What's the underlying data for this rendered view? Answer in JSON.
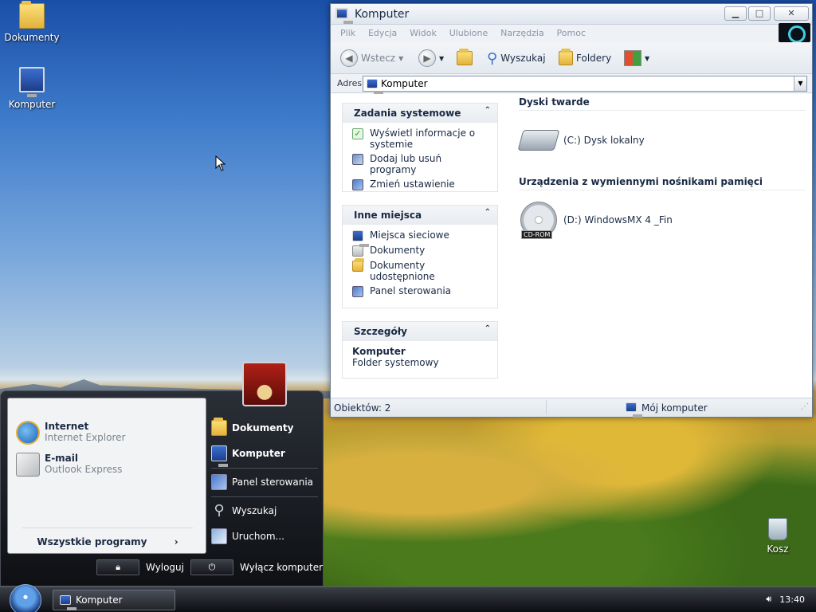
{
  "desktop": {
    "icons": [
      {
        "label": "Dokumenty"
      },
      {
        "label": "Komputer"
      },
      {
        "label": "Kosz"
      }
    ]
  },
  "window": {
    "title": "Komputer",
    "controls": {
      "minimize": "▁",
      "maximize": "□",
      "close": "✕"
    },
    "menu": [
      "Plik",
      "Edycja",
      "Widok",
      "Ulubione",
      "Narzędzia",
      "Pomoc"
    ],
    "toolbar": {
      "back": "Wstecz",
      "search": "Wyszukaj",
      "folders": "Foldery"
    },
    "address": {
      "label": "Adres",
      "value": "Komputer"
    },
    "panels": {
      "system_tasks": {
        "title": "Zadania systemowe",
        "items": [
          "Wyświetl informacje o systemie",
          "Dodaj lub usuń programy",
          "Zmień ustawienie"
        ]
      },
      "other_places": {
        "title": "Inne miejsca",
        "items": [
          "Miejsca sieciowe",
          "Dokumenty",
          "Dokumenty udostępnione",
          "Panel sterowania"
        ]
      },
      "details": {
        "title": "Szczegóły",
        "name": "Komputer",
        "desc": "Folder systemowy"
      }
    },
    "groups": {
      "hard_disks": {
        "title": "Dyski twarde",
        "items": [
          "(C:) Dysk lokalny"
        ]
      },
      "removable": {
        "title": "Urządzenia z wymiennymi nośnikami pamięci",
        "items": [
          "(D:) WindowsMX 4 _Fin"
        ],
        "badge": "CD-ROM"
      }
    },
    "status": {
      "left": "Obiektów: 2",
      "right": "Mój komputer"
    }
  },
  "start_menu": {
    "pinned": [
      {
        "title": "Internet",
        "subtitle": "Internet Explorer"
      },
      {
        "title": "E-mail",
        "subtitle": "Outlook Express"
      }
    ],
    "all_programs": "Wszystkie programy",
    "right": [
      "Dokumenty",
      "Komputer",
      "Panel sterowania",
      "Wyszukaj",
      "Uruchom..."
    ],
    "logoff": "Wyloguj",
    "shutdown": "Wyłącz komputer"
  },
  "taskbar": {
    "task": "Komputer",
    "clock": "13:40"
  }
}
